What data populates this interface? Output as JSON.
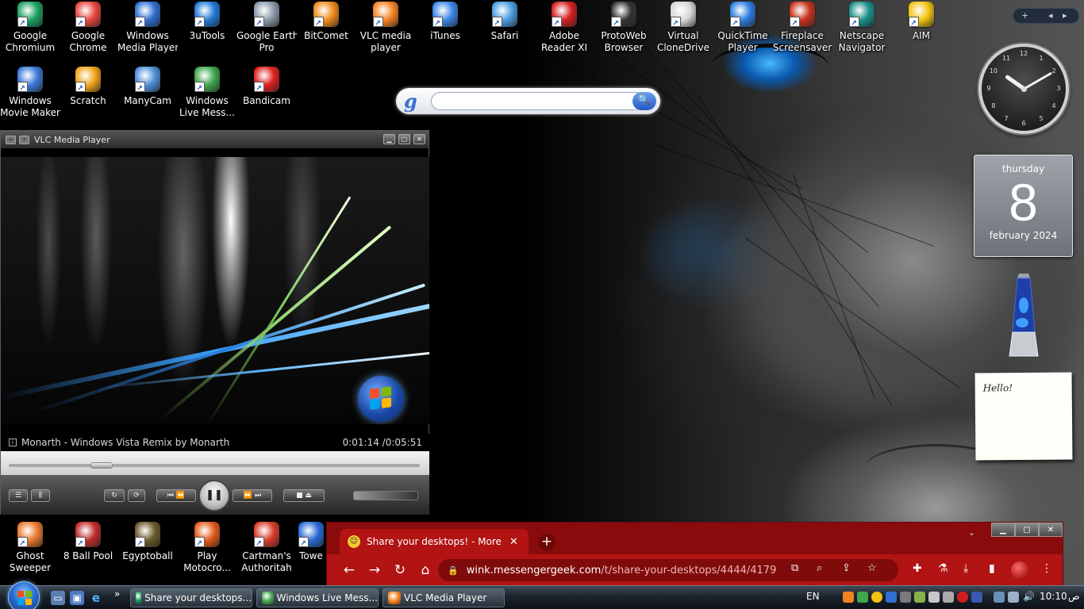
{
  "desktop": {
    "icons_row1": [
      {
        "label1": "Google",
        "label2": "Chromium",
        "color": "#1aa260",
        "icon": "chromium-icon"
      },
      {
        "label1": "Google",
        "label2": "Chrome",
        "color": "#e8453c",
        "icon": "chrome-icon"
      },
      {
        "label1": "Windows",
        "label2": "Media Player",
        "color": "#2f6fd0",
        "icon": "media-player-icon"
      },
      {
        "label1": "3uTools",
        "label2": "",
        "color": "#1f7ad6",
        "icon": "3utools-icon"
      },
      {
        "label1": "Google Earth",
        "label2": "Pro",
        "color": "#8a99ab",
        "icon": "google-earth-icon"
      },
      {
        "label1": "BitComet",
        "label2": "",
        "color": "#f08a1a",
        "icon": "bitcomet-icon"
      },
      {
        "label1": "VLC media",
        "label2": "player",
        "color": "#f58220",
        "icon": "vlc-icon"
      },
      {
        "label1": "iTunes",
        "label2": "",
        "color": "#3a86e8",
        "icon": "itunes-icon"
      },
      {
        "label1": "Safari",
        "label2": "",
        "color": "#4a9ce0",
        "icon": "safari-icon"
      },
      {
        "label1": "Adobe",
        "label2": "Reader XI",
        "color": "#d31f1f",
        "icon": "adobe-reader-icon"
      },
      {
        "label1": "ProtoWeb",
        "label2": "Browser",
        "color": "#333333",
        "icon": "protoweb-icon"
      },
      {
        "label1": "Virtual",
        "label2": "CloneDrive",
        "color": "#d8d8d8",
        "icon": "clonedrive-icon"
      },
      {
        "label1": "QuickTime",
        "label2": "Player",
        "color": "#2b7de0",
        "icon": "quicktime-icon"
      },
      {
        "label1": "Fireplace",
        "label2": "Screensaver",
        "color": "#c8321a",
        "icon": "fireplace-icon"
      },
      {
        "label1": "Netscape",
        "label2": "Navigator",
        "color": "#1a8f8a",
        "icon": "netscape-icon"
      },
      {
        "label1": "AIM",
        "label2": "",
        "color": "#f2c40f",
        "icon": "aim-icon"
      }
    ],
    "icons_row2": [
      {
        "label1": "Windows",
        "label2": "Movie Maker",
        "color": "#3a78d8",
        "icon": "movie-maker-icon"
      },
      {
        "label1": "Scratch",
        "label2": "",
        "color": "#f2a318",
        "icon": "scratch-icon"
      },
      {
        "label1": "ManyCam",
        "label2": "",
        "color": "#4d8fd8",
        "icon": "manycam-icon"
      },
      {
        "label1": "Windows",
        "label2": "Live Mess...",
        "color": "#3fa64a",
        "icon": "live-messenger-icon"
      },
      {
        "label1": "Bandicam",
        "label2": "",
        "color": "#e02020",
        "icon": "bandicam-icon"
      }
    ],
    "icons_bottom": [
      {
        "label1": "Ghost",
        "label2": "Sweeper",
        "color": "#e8782a",
        "icon": "ghost-sweeper-icon"
      },
      {
        "label1": "8 Ball Pool",
        "label2": "",
        "color": "#c02a2a",
        "icon": "8-ball-pool-icon"
      },
      {
        "label1": "Egyptoball",
        "label2": "",
        "color": "#6b5a2a",
        "icon": "egyptoball-icon"
      },
      {
        "label1": "Play",
        "label2": "Motocro...",
        "color": "#e25a1a",
        "icon": "motocross-icon"
      },
      {
        "label1": "Cartman's",
        "label2": "Authoritah",
        "color": "#d83a2a",
        "icon": "cartman-icon"
      },
      {
        "label1": "Towe",
        "label2": "",
        "color": "#2a6ad8",
        "icon": "tower-icon"
      }
    ]
  },
  "search_gadget": {
    "logo": "g",
    "button": "🔍"
  },
  "sidebar": {
    "add": "+",
    "prev": "◂",
    "next": "▸"
  },
  "clock": {
    "hour": 10,
    "minute": 10
  },
  "calendar": {
    "dow": "thursday",
    "day": "8",
    "month": "february 2024"
  },
  "note": {
    "text": "Hello!"
  },
  "vlc": {
    "title": "VLC Media Player",
    "now_playing": "Monarth - Windows Vista Remix by Monarth",
    "time": "0:01:14 /0:05:51",
    "progress": 0.21
  },
  "chrome": {
    "tab_title": "Share your desktops! - More / Sl",
    "tab_close": "✕",
    "new_tab": "+",
    "url_host": "wink.messengergeek.com",
    "url_path": "/t/share-your-desktops/4444/4179",
    "controls": {
      "min": "▁",
      "max": "▢",
      "close": "✕"
    },
    "dropdown": "⌄"
  },
  "taskbar": {
    "buttons": [
      {
        "label": "Share your desktops...",
        "color": "#1aa260"
      },
      {
        "label": "Windows Live Mess...",
        "color": "#3fa64a"
      },
      {
        "label": "VLC Media Player",
        "color": "#f58220"
      }
    ],
    "overflow": "»",
    "language": "EN",
    "time": "10:10",
    "ampm": "ص"
  }
}
